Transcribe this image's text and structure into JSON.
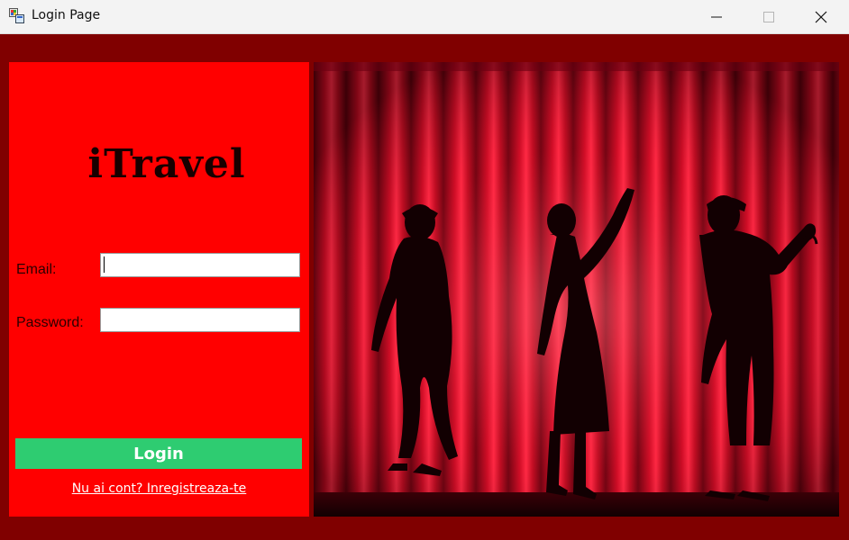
{
  "window": {
    "title": "Login Page",
    "controls": {
      "minimize": "minimize",
      "maximize": "maximize",
      "close": "close"
    }
  },
  "colors": {
    "window_bg": "#800000",
    "form_bg": "#ff0000",
    "login_button": "#2ecc71"
  },
  "form": {
    "brand": "iTravel",
    "email_label": "Email:",
    "email_value": "",
    "password_label": "Password:",
    "password_value": "",
    "login_button": "Login",
    "register_link": "Nu ai cont? Inregistreaza-te"
  },
  "image": {
    "subject": "silhouettes-on-red-theater-curtain"
  }
}
